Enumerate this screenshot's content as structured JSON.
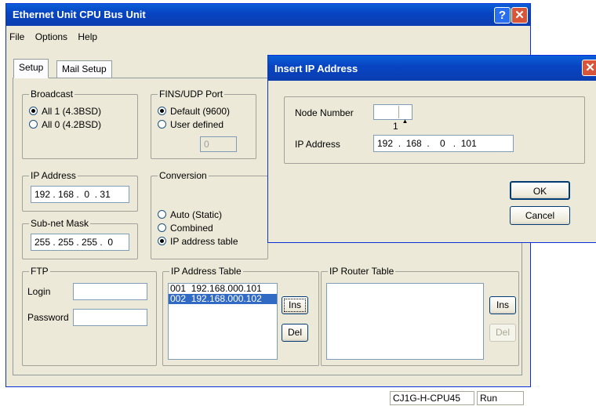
{
  "main_window": {
    "title": "Ethernet Unit CPU Bus Unit",
    "help_glyph": "?",
    "close_glyph": "✕",
    "menu": [
      "File",
      "Options",
      "Help"
    ],
    "tabs": [
      "Setup",
      "Mail Setup"
    ],
    "active_tab": "Setup",
    "broadcast": {
      "label": "Broadcast",
      "options": [
        "All 1 (4.3BSD)",
        "All 0 (4.2BSD)"
      ],
      "selected": "All 1 (4.3BSD)"
    },
    "fins_udp": {
      "label": "FINS/UDP Port",
      "options": [
        "Default (9600)",
        "User defined"
      ],
      "selected": "Default (9600)",
      "port_value": "0"
    },
    "ip_address": {
      "label": "IP Address",
      "value": "192 . 168 .  0  . 31"
    },
    "subnet_mask": {
      "label": "Sub-net Mask",
      "value": "255 . 255 . 255 .  0"
    },
    "conversion": {
      "label": "Conversion",
      "options": [
        "Auto (Static)",
        "Combined",
        "IP address table"
      ],
      "selected": "IP address table"
    },
    "ftp": {
      "label": "FTP",
      "login_label": "Login",
      "password_label": "Password",
      "login_value": "",
      "password_value": ""
    },
    "ip_address_table": {
      "label": "IP Address Table",
      "rows": [
        "001  192.168.000.101",
        "002  192.168.000.102"
      ],
      "selected_index": 1,
      "ins_label": "Ins",
      "del_label": "Del"
    },
    "ip_router_table": {
      "label": "IP Router Table",
      "rows": [],
      "ins_label": "Ins",
      "del_label": "Del"
    },
    "status": {
      "model": "CJ1G-H-CPU45",
      "mode": "Run"
    }
  },
  "dialog": {
    "title": "Insert IP Address",
    "close_glyph": "✕",
    "node_label": "Node Number",
    "node_value": "1",
    "ip_label": "IP Address",
    "ip_value": "192  .  168  .    0   .  101",
    "ok_label": "OK",
    "cancel_label": "Cancel"
  }
}
